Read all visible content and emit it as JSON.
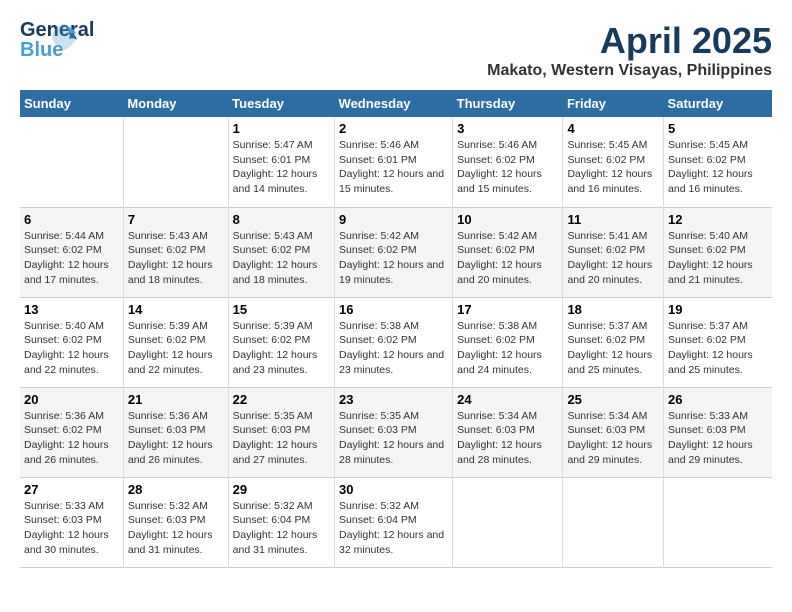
{
  "logo": {
    "line1": "General",
    "line2": "Blue",
    "bird_unicode": "🐦"
  },
  "header": {
    "month": "April 2025",
    "location": "Makato, Western Visayas, Philippines"
  },
  "weekdays": [
    "Sunday",
    "Monday",
    "Tuesday",
    "Wednesday",
    "Thursday",
    "Friday",
    "Saturday"
  ],
  "weeks": [
    [
      {
        "day": "",
        "info": ""
      },
      {
        "day": "",
        "info": ""
      },
      {
        "day": "1",
        "info": "Sunrise: 5:47 AM\nSunset: 6:01 PM\nDaylight: 12 hours and 14 minutes."
      },
      {
        "day": "2",
        "info": "Sunrise: 5:46 AM\nSunset: 6:01 PM\nDaylight: 12 hours and 15 minutes."
      },
      {
        "day": "3",
        "info": "Sunrise: 5:46 AM\nSunset: 6:02 PM\nDaylight: 12 hours and 15 minutes."
      },
      {
        "day": "4",
        "info": "Sunrise: 5:45 AM\nSunset: 6:02 PM\nDaylight: 12 hours and 16 minutes."
      },
      {
        "day": "5",
        "info": "Sunrise: 5:45 AM\nSunset: 6:02 PM\nDaylight: 12 hours and 16 minutes."
      }
    ],
    [
      {
        "day": "6",
        "info": "Sunrise: 5:44 AM\nSunset: 6:02 PM\nDaylight: 12 hours and 17 minutes."
      },
      {
        "day": "7",
        "info": "Sunrise: 5:43 AM\nSunset: 6:02 PM\nDaylight: 12 hours and 18 minutes."
      },
      {
        "day": "8",
        "info": "Sunrise: 5:43 AM\nSunset: 6:02 PM\nDaylight: 12 hours and 18 minutes."
      },
      {
        "day": "9",
        "info": "Sunrise: 5:42 AM\nSunset: 6:02 PM\nDaylight: 12 hours and 19 minutes."
      },
      {
        "day": "10",
        "info": "Sunrise: 5:42 AM\nSunset: 6:02 PM\nDaylight: 12 hours and 20 minutes."
      },
      {
        "day": "11",
        "info": "Sunrise: 5:41 AM\nSunset: 6:02 PM\nDaylight: 12 hours and 20 minutes."
      },
      {
        "day": "12",
        "info": "Sunrise: 5:40 AM\nSunset: 6:02 PM\nDaylight: 12 hours and 21 minutes."
      }
    ],
    [
      {
        "day": "13",
        "info": "Sunrise: 5:40 AM\nSunset: 6:02 PM\nDaylight: 12 hours and 22 minutes."
      },
      {
        "day": "14",
        "info": "Sunrise: 5:39 AM\nSunset: 6:02 PM\nDaylight: 12 hours and 22 minutes."
      },
      {
        "day": "15",
        "info": "Sunrise: 5:39 AM\nSunset: 6:02 PM\nDaylight: 12 hours and 23 minutes."
      },
      {
        "day": "16",
        "info": "Sunrise: 5:38 AM\nSunset: 6:02 PM\nDaylight: 12 hours and 23 minutes."
      },
      {
        "day": "17",
        "info": "Sunrise: 5:38 AM\nSunset: 6:02 PM\nDaylight: 12 hours and 24 minutes."
      },
      {
        "day": "18",
        "info": "Sunrise: 5:37 AM\nSunset: 6:02 PM\nDaylight: 12 hours and 25 minutes."
      },
      {
        "day": "19",
        "info": "Sunrise: 5:37 AM\nSunset: 6:02 PM\nDaylight: 12 hours and 25 minutes."
      }
    ],
    [
      {
        "day": "20",
        "info": "Sunrise: 5:36 AM\nSunset: 6:02 PM\nDaylight: 12 hours and 26 minutes."
      },
      {
        "day": "21",
        "info": "Sunrise: 5:36 AM\nSunset: 6:03 PM\nDaylight: 12 hours and 26 minutes."
      },
      {
        "day": "22",
        "info": "Sunrise: 5:35 AM\nSunset: 6:03 PM\nDaylight: 12 hours and 27 minutes."
      },
      {
        "day": "23",
        "info": "Sunrise: 5:35 AM\nSunset: 6:03 PM\nDaylight: 12 hours and 28 minutes."
      },
      {
        "day": "24",
        "info": "Sunrise: 5:34 AM\nSunset: 6:03 PM\nDaylight: 12 hours and 28 minutes."
      },
      {
        "day": "25",
        "info": "Sunrise: 5:34 AM\nSunset: 6:03 PM\nDaylight: 12 hours and 29 minutes."
      },
      {
        "day": "26",
        "info": "Sunrise: 5:33 AM\nSunset: 6:03 PM\nDaylight: 12 hours and 29 minutes."
      }
    ],
    [
      {
        "day": "27",
        "info": "Sunrise: 5:33 AM\nSunset: 6:03 PM\nDaylight: 12 hours and 30 minutes."
      },
      {
        "day": "28",
        "info": "Sunrise: 5:32 AM\nSunset: 6:03 PM\nDaylight: 12 hours and 31 minutes."
      },
      {
        "day": "29",
        "info": "Sunrise: 5:32 AM\nSunset: 6:04 PM\nDaylight: 12 hours and 31 minutes."
      },
      {
        "day": "30",
        "info": "Sunrise: 5:32 AM\nSunset: 6:04 PM\nDaylight: 12 hours and 32 minutes."
      },
      {
        "day": "",
        "info": ""
      },
      {
        "day": "",
        "info": ""
      },
      {
        "day": "",
        "info": ""
      }
    ]
  ]
}
